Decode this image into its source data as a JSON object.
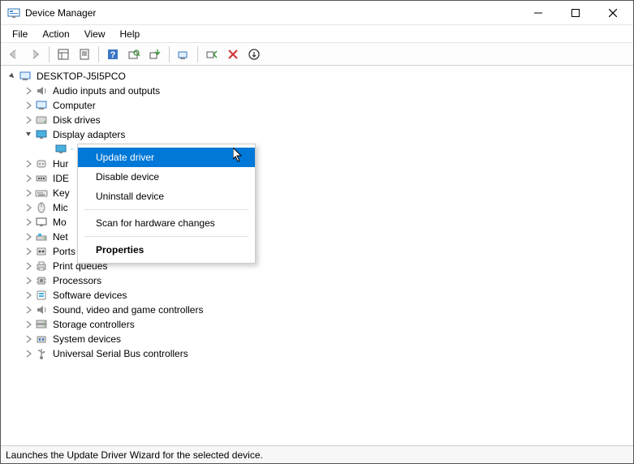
{
  "window": {
    "title": "Device Manager"
  },
  "menubar": {
    "items": [
      "File",
      "Action",
      "View",
      "Help"
    ]
  },
  "tree": {
    "root": "DESKTOP-J5I5PCO",
    "categories": [
      {
        "label": "Audio inputs and outputs",
        "icon": "audio",
        "expanded": false
      },
      {
        "label": "Computer",
        "icon": "computer",
        "expanded": false
      },
      {
        "label": "Disk drives",
        "icon": "disk",
        "expanded": false
      },
      {
        "label": "Display adapters",
        "icon": "display",
        "expanded": true
      },
      {
        "label": "Hur",
        "icon": "hid",
        "expanded": false,
        "truncated": true
      },
      {
        "label": "IDE",
        "icon": "ide",
        "expanded": false,
        "truncated": true
      },
      {
        "label": "Key",
        "icon": "keyboard",
        "expanded": false,
        "truncated": true
      },
      {
        "label": "Mic",
        "icon": "mouse",
        "expanded": false,
        "truncated": true
      },
      {
        "label": "Mo",
        "icon": "monitor",
        "expanded": false,
        "truncated": true
      },
      {
        "label": "Net",
        "icon": "network",
        "expanded": false,
        "truncated": true
      },
      {
        "label": "Ports (COM & LPT)",
        "icon": "port",
        "expanded": false,
        "obscured": true
      },
      {
        "label": "Print queues",
        "icon": "printer",
        "expanded": false
      },
      {
        "label": "Processors",
        "icon": "cpu",
        "expanded": false
      },
      {
        "label": "Software devices",
        "icon": "software",
        "expanded": false
      },
      {
        "label": "Sound, video and game controllers",
        "icon": "sound",
        "expanded": false
      },
      {
        "label": "Storage controllers",
        "icon": "storage",
        "expanded": false
      },
      {
        "label": "System devices",
        "icon": "system",
        "expanded": false
      },
      {
        "label": "Universal Serial Bus controllers",
        "icon": "usb",
        "expanded": false
      }
    ]
  },
  "context_menu": {
    "items": [
      {
        "label": "Update driver",
        "highlighted": true
      },
      {
        "label": "Disable device"
      },
      {
        "label": "Uninstall device"
      },
      {
        "sep": true
      },
      {
        "label": "Scan for hardware changes"
      },
      {
        "sep": true
      },
      {
        "label": "Properties",
        "bold": true
      }
    ]
  },
  "statusbar": {
    "text": "Launches the Update Driver Wizard for the selected device."
  }
}
